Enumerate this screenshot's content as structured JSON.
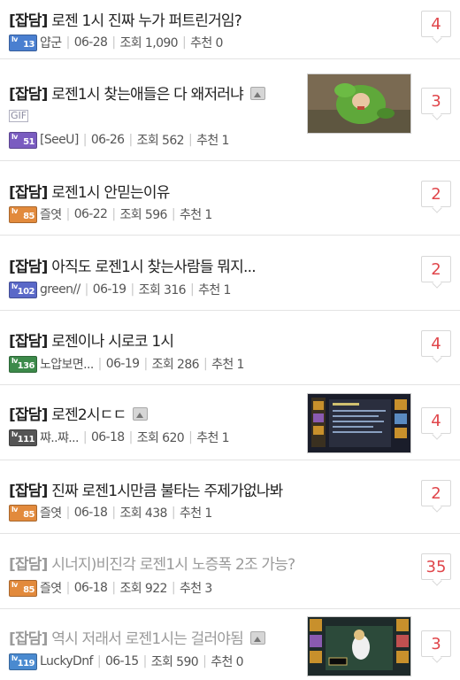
{
  "posts": [
    {
      "category": "[잡담]",
      "title": "로젠 1시 진짜 누가 퍼트린거임?",
      "author": "얍군",
      "level": "13",
      "date": "06-28",
      "views": "조회 1,090",
      "likes": "추천 0",
      "comments": "4",
      "badge_color": "#4a7fd0"
    },
    {
      "category": "[잡담]",
      "title": "로젠1시 찾는애들은 다 왜저러냐",
      "gif": "GIF",
      "author": "[SeeU]",
      "level": "51",
      "date": "06-26",
      "views": "조회 562",
      "likes": "추천 1",
      "comments": "3",
      "badge_color": "#7a5cc0"
    },
    {
      "category": "[잡담]",
      "title": "로젠1시 안믿는이유",
      "author": "즐엿",
      "level": "85",
      "date": "06-22",
      "views": "조회 596",
      "likes": "추천 1",
      "comments": "2",
      "badge_color": "#e28a3c"
    },
    {
      "category": "[잡담]",
      "title": "아직도 로젠1시 찾는사람들 뭐지...",
      "author": "green//",
      "level": "102",
      "date": "06-19",
      "views": "조회 316",
      "likes": "추천 1",
      "comments": "2",
      "badge_color": "#5a68c8"
    },
    {
      "category": "[잡담]",
      "title": "로젠이나 시로코 1시",
      "author": "노압보면...",
      "level": "136",
      "date": "06-19",
      "views": "조회 286",
      "likes": "추천 1",
      "comments": "4",
      "badge_color": "#3c8a4a"
    },
    {
      "category": "[잡담]",
      "title": "로젠2시ㄷㄷ",
      "author": "쨔..쨔...",
      "level": "111",
      "date": "06-18",
      "views": "조회 620",
      "likes": "추천 1",
      "comments": "4",
      "badge_color": "#555555"
    },
    {
      "category": "[잡담]",
      "title": "진짜 로젠1시만큼 불타는 주제가없나봐",
      "author": "즐엿",
      "level": "85",
      "date": "06-18",
      "views": "조회 438",
      "likes": "추천 1",
      "comments": "2",
      "badge_color": "#e28a3c"
    },
    {
      "category": "[잡담]",
      "title": "시너지)비진각 로젠1시 노증폭 2조 가능?",
      "author": "즐엿",
      "level": "85",
      "date": "06-18",
      "views": "조회 922",
      "likes": "추천 3",
      "comments": "35",
      "badge_color": "#e28a3c"
    },
    {
      "category": "[잡담]",
      "title": "역시 저래서 로젠1시는 걸러야됨",
      "author": "LuckyDnf",
      "level": "119",
      "date": "06-15",
      "views": "조회 590",
      "likes": "추천 0",
      "comments": "3",
      "badge_color": "#4a8ad0"
    }
  ],
  "colors": {
    "comment_count": "#e0464b",
    "visited_title": "#9a9a9a",
    "separator": "#c8c8c8"
  }
}
